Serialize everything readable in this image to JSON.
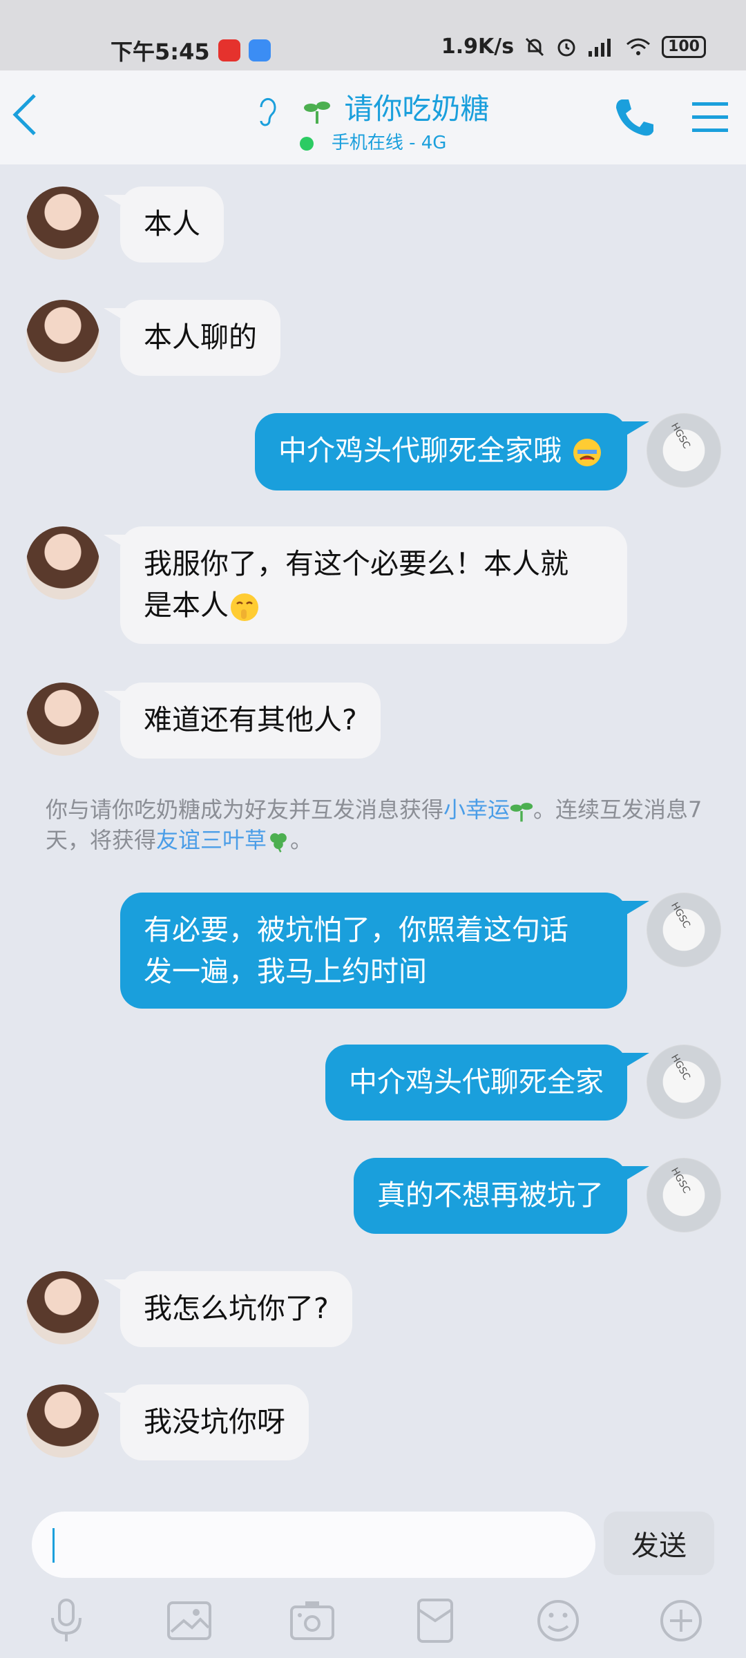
{
  "status_bar": {
    "time": "下午5:45",
    "network_speed": "1.9K/s",
    "battery": "100",
    "icons": [
      "netease-music-icon",
      "app-icon",
      "mute-bell-icon",
      "alarm-icon",
      "signal-icon",
      "wifi-icon",
      "battery-icon"
    ]
  },
  "header": {
    "title": "请你吃奶糖",
    "status": "手机在线 - 4G",
    "icons": [
      "back-icon",
      "earpiece-icon",
      "sprout-icon",
      "phone-icon",
      "menu-icon"
    ]
  },
  "messages": [
    {
      "side": "in",
      "text": "本人"
    },
    {
      "side": "in",
      "text": "本人聊的"
    },
    {
      "side": "out",
      "text": "中介鸡头代聊死全家哦",
      "emoji": "crying-emoji"
    },
    {
      "side": "in",
      "text": "我服你了，有这个必要么！本人就是本人",
      "line1": "我服你了，有这个必要么！本人就",
      "line2": "是本人",
      "emoji": "shh-emoji"
    },
    {
      "side": "in",
      "text": "难道还有其他人?"
    },
    {
      "side": "out",
      "text": "有必要，被坑怕了，你照着这句话发一遍，我马上约时间",
      "line1": "有必要，被坑怕了，你照着这句话",
      "line2": "发一遍，我马上约时间"
    },
    {
      "side": "out",
      "text": "中介鸡头代聊死全家"
    },
    {
      "side": "out",
      "text": "真的不想再被坑了"
    },
    {
      "side": "in",
      "text": "我怎么坑你了?"
    },
    {
      "side": "in",
      "text": "我没坑你呀"
    }
  ],
  "system_notice": {
    "part1": "你与请你吃奶糖成为好友并互发消息获得",
    "link1": "小幸运",
    "part2": "。连续互发消息7",
    "part3": "天，将获得",
    "link2": "友谊三叶草",
    "part4": "。"
  },
  "my_avatar_stamp": "HGSC",
  "input": {
    "value": "",
    "send_label": "发送"
  },
  "toolbar": [
    "voice-icon",
    "image-icon",
    "camera-icon",
    "red-packet-icon",
    "emoji-icon",
    "plus-icon"
  ]
}
